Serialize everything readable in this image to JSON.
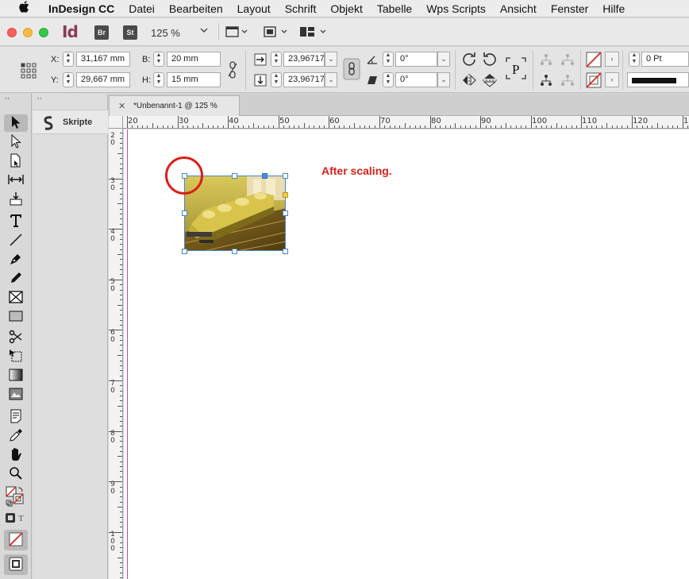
{
  "menubar": {
    "app_name": "InDesign CC",
    "items": [
      "Datei",
      "Bearbeiten",
      "Layout",
      "Schrift",
      "Objekt",
      "Tabelle",
      "Wps Scripts",
      "Ansicht",
      "Fenster",
      "Hilfe"
    ]
  },
  "appbar": {
    "logo": "Id",
    "bridge": "Br",
    "stock": "St",
    "zoom": "125 %"
  },
  "control": {
    "x_label": "X:",
    "x_value": "31,167 mm",
    "y_label": "Y:",
    "y_value": "29,667 mm",
    "w_label": "B:",
    "w_value": "20 mm",
    "h_label": "H:",
    "h_value": "15 mm",
    "scale_x": "23,96717",
    "scale_y": "23,96717",
    "rotate": "0°",
    "shear": "0°",
    "stroke_weight": "0 Pt"
  },
  "panel": {
    "scripts_label": "Skripte"
  },
  "document": {
    "tab_title": "*Unbenannt-1 @ 125 %",
    "annotation": "After scaling."
  },
  "ruler": {
    "h_labels": [
      "20",
      "30",
      "40",
      "50",
      "60",
      "70",
      "80",
      "90",
      "100",
      "110",
      "120",
      "1"
    ],
    "v_labels": [
      [
        "2",
        "0"
      ],
      [
        "3",
        "0"
      ],
      [
        "4",
        "0"
      ],
      [
        "5",
        "0"
      ],
      [
        "6",
        "0"
      ],
      [
        "7",
        "0"
      ],
      [
        "8",
        "0"
      ],
      [
        "9",
        "0"
      ],
      [
        "1",
        "0",
        "0"
      ]
    ]
  },
  "colors": {
    "annotation_red": "#d9201b",
    "selection_blue": "#4a86c8",
    "margin_magenta": "#b54ea6"
  }
}
